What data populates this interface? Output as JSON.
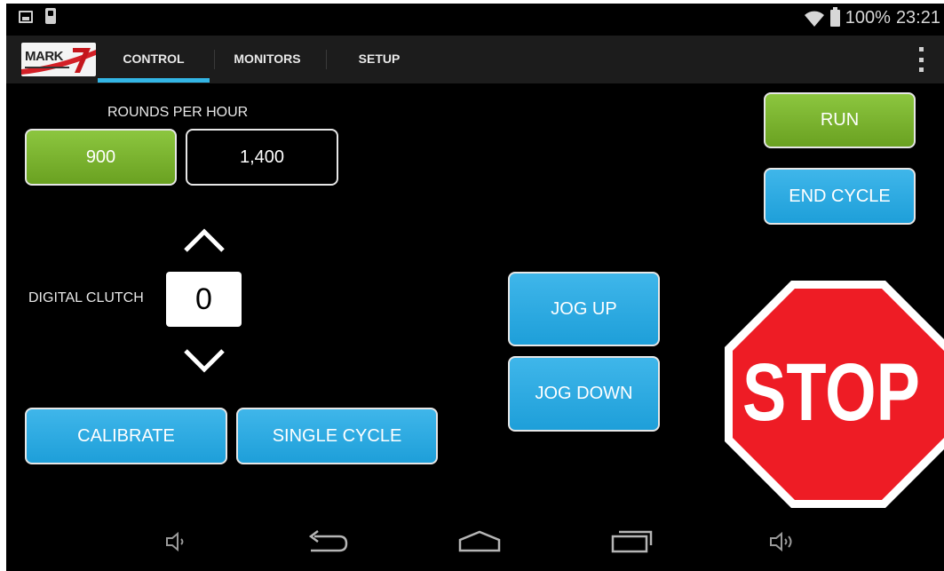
{
  "status_bar": {
    "left_icons": [
      "picture-notification-icon",
      "usb-notification-icon"
    ],
    "right_icons": [
      "wifi-icon",
      "battery-icon"
    ],
    "battery_text": "100%",
    "time": "23:21"
  },
  "action_bar": {
    "logo_text": "MARK",
    "logo_number": "7",
    "tabs": [
      {
        "label": "CONTROL",
        "active": true
      },
      {
        "label": "MONITORS",
        "active": false
      },
      {
        "label": "SETUP",
        "active": false
      }
    ],
    "accent_color": "#33b5e5"
  },
  "control": {
    "rounds_per_hour": {
      "label": "ROUNDS PER HOUR",
      "options": [
        "900",
        "1,400"
      ],
      "selected": "900"
    },
    "digital_clutch": {
      "label": "DIGITAL CLUTCH",
      "value": "0"
    },
    "buttons": {
      "calibrate": "CALIBRATE",
      "single_cycle": "SINGLE CYCLE",
      "jog_up": "JOG UP",
      "jog_down": "JOG DOWN",
      "run": "RUN",
      "end_cycle": "END CYCLE"
    },
    "stop_sign_text": "STOP",
    "colors": {
      "green": "#7ab32e",
      "blue": "#29a9e1",
      "stop_red": "#ee1c25"
    }
  },
  "nav_bar": {
    "icons": [
      "volume-down-icon",
      "back-icon",
      "home-icon",
      "recent-apps-icon",
      "volume-up-icon"
    ]
  }
}
